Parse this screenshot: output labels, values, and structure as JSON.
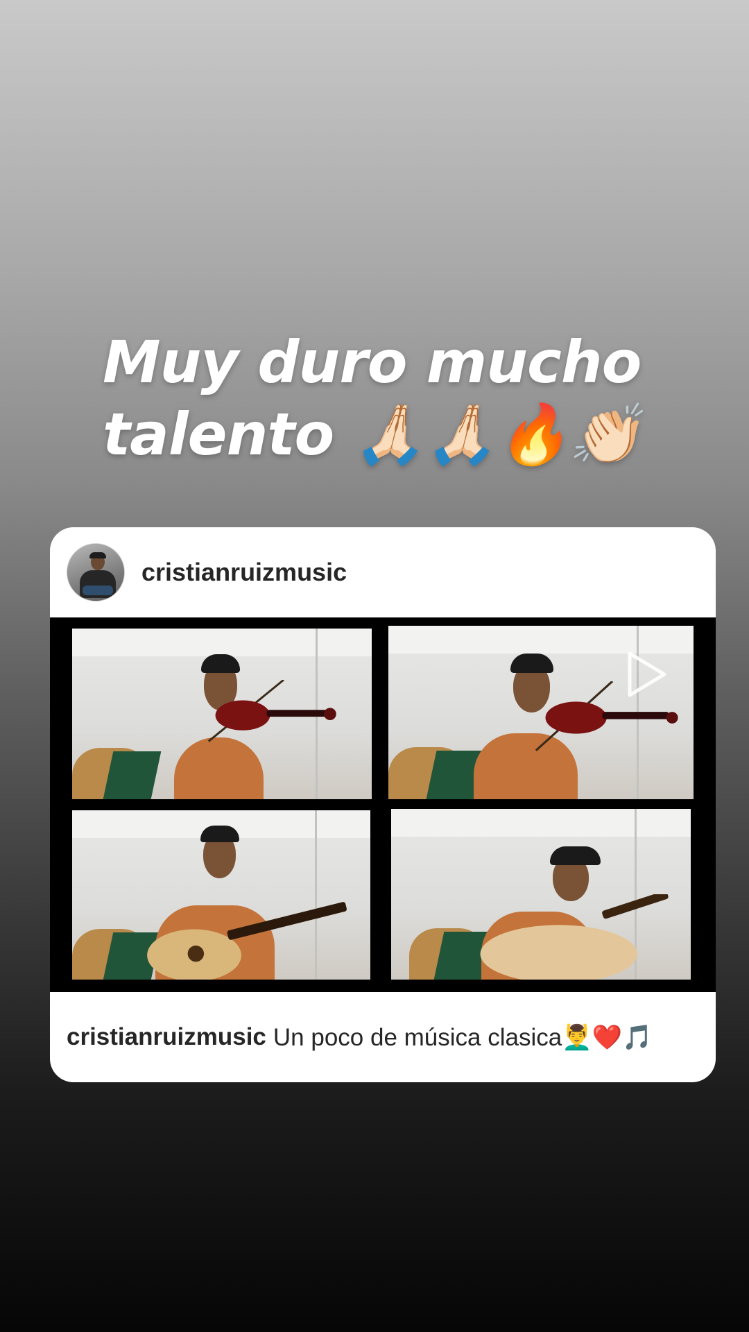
{
  "story": {
    "caption_line1": "Muy duro mucho",
    "caption_line2": "talento 🙏🏻🙏🏻🔥👏🏻"
  },
  "post": {
    "username": "cristianruizmusic",
    "caption_username": "cristianruizmusic",
    "caption_text": "Un poco de música clasica💆‍♂️❤️🎵",
    "media_type_icon": "play-icon",
    "tiles": [
      {
        "instrument": "violin"
      },
      {
        "instrument": "violin"
      },
      {
        "instrument": "guitar"
      },
      {
        "instrument": "vihuela"
      }
    ]
  },
  "colors": {
    "card_background": "#ffffff",
    "text_primary": "#262626",
    "media_background": "#000000",
    "caption_text": "#ffffff"
  }
}
